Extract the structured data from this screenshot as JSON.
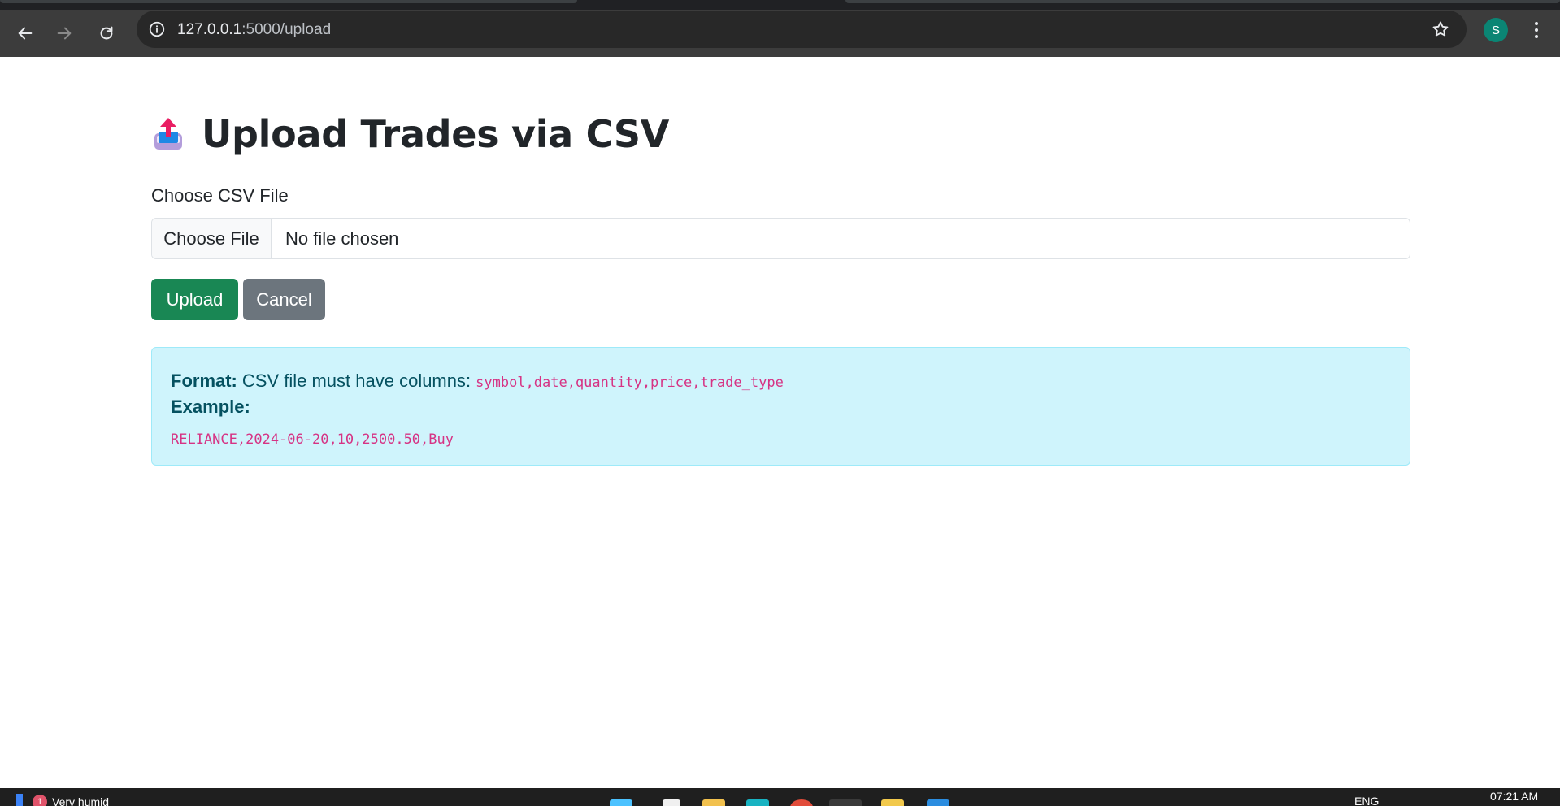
{
  "browser": {
    "url_host": "127.0.0.1",
    "url_path": ":5000/upload",
    "profile_initial": "S"
  },
  "page": {
    "title": "Upload Trades via CSV",
    "file_label": "Choose CSV File",
    "choose_file_button": "Choose File",
    "file_status": "No file chosen",
    "upload_button": "Upload",
    "cancel_button": "Cancel",
    "alert": {
      "format_label": "Format:",
      "format_text": "CSV file must have columns:",
      "columns": "symbol,date,quantity,price,trade_type",
      "example_label": "Example:",
      "example_row": "RELIANCE,2024-06-20,10,2500.50,Buy"
    }
  },
  "taskbar": {
    "weather_badge": "1",
    "weather_text": "Very humid",
    "language": "ENG",
    "time": "07:21 AM"
  },
  "colors": {
    "upload": "#198754",
    "cancel": "#6c757d",
    "alert_bg": "#cff4fc",
    "alert_text": "#055160",
    "code": "#d63384",
    "avatar": "#0b8574"
  }
}
